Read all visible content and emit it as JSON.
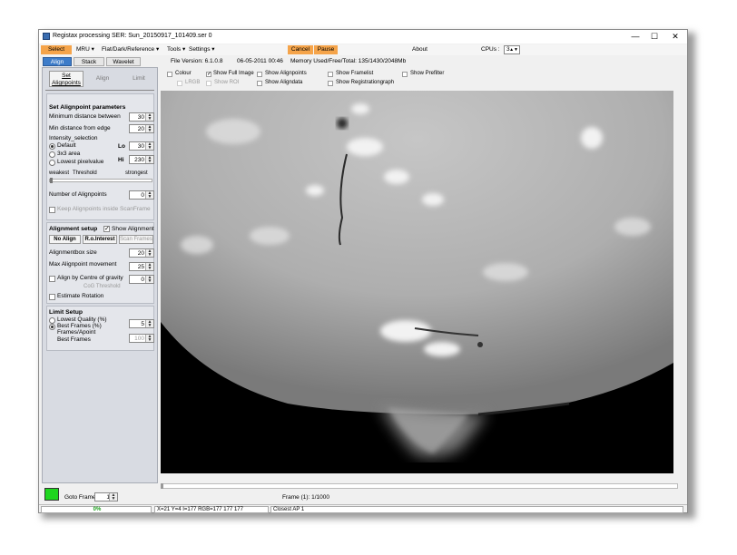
{
  "window": {
    "title": "Registax processing SER: Sun_20150917_101409.ser  0"
  },
  "menu": {
    "select": "Select",
    "mru": "MRU ▾",
    "flat": "Flat/Dark/Reference ▾",
    "tools": "Tools ▾",
    "settings": "Settings ▾",
    "cancel": "Cancel",
    "pause": "Pause",
    "about": "About",
    "cpus_label": "CPUs :",
    "cpus_value": "3",
    "file_version": "File Version: 6.1.0.8",
    "date": "06-05-2011 00:46",
    "memory": "Memory Used/Free/Total: 135/1430/2048Mb"
  },
  "tabs": {
    "align": "Align",
    "stack": "Stack",
    "wavelet": "Wavelet"
  },
  "panel": {
    "set_alignpoints": [
      "Set",
      "Alignpoints"
    ],
    "align": "Align",
    "limit": "Limit",
    "set_params_header": "Set Alignpoint parameters",
    "min_distance": {
      "label": "Minimum distance between",
      "value": "30"
    },
    "min_edge": {
      "label": "Min distance from edge",
      "value": "20"
    },
    "intensity_header": "Intensity_selection",
    "radio_default": "Default",
    "radio_3x3": "3x3 area",
    "radio_lowest": "Lowest pixelvalue",
    "lo": {
      "label": "Lo",
      "value": "30"
    },
    "hi": {
      "label": "Hi",
      "value": "230"
    },
    "weakest": "weakest",
    "threshold": "Threshold",
    "strongest": "strongest",
    "num_alignpoints": {
      "label": "Number of Alignpoints",
      "value": "0"
    },
    "keep_inside": "Keep Alignpoints inside ScanFrame",
    "alignment_setup": "Alignment setup",
    "show_alignment": "Show Alignment",
    "no_align": "No Align",
    "roi": "R.o.Interest",
    "scan_frames": "Scan Frames",
    "alignbox": {
      "label": "Alignmentbox size",
      "value": "20"
    },
    "max_movement": {
      "label": "Max Alignpoint movement",
      "value": "25"
    },
    "centre_gravity": {
      "label": "Align by Centre of gravity",
      "value": "0"
    },
    "cog_threshold": "CoG Threshold",
    "estimate_rotation": "Estimate Rotation",
    "limit_setup": "Limit Setup",
    "lowest_quality": {
      "label": "Lowest Quality (%)",
      "value": "5"
    },
    "best_frames_pct": "Best Frames (%)",
    "frames_apoint": "Frames/Apoint",
    "best_frames": {
      "label": "Best Frames",
      "value": "100"
    }
  },
  "options": {
    "colour": "Colour",
    "show_full_image": "Show Full Image",
    "show_alignpoints": "Show Alignpoints",
    "show_framelist": "Show Framelist",
    "show_prefilter": "Show Prefilter",
    "lrgb": "LRGB",
    "show_roi": "Show ROI",
    "show_aligndata": "Show Aligndata",
    "show_registrationgraph": "Show Registrationgraph"
  },
  "bottom": {
    "goto_frame": "Goto Frame",
    "goto_value": "1",
    "frame_info": "Frame (1): 1/1000"
  },
  "status": {
    "progress": "0%",
    "pixel": "X=21 Y=4 I=177 RGB=177 177 177",
    "closest": "Closest AP 1"
  }
}
